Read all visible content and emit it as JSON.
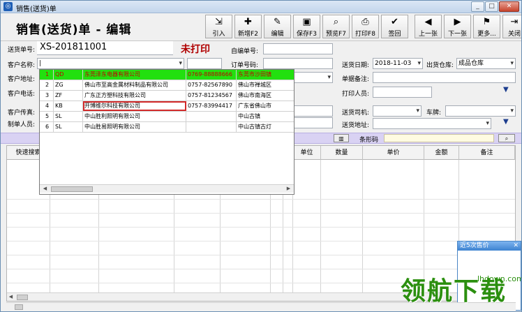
{
  "window": {
    "title": "销售(送货)单",
    "app_icon": "app-logo-icon"
  },
  "header": {
    "doc_title": "销售(送货)单 - 编辑"
  },
  "toolbar": [
    {
      "label": "引入",
      "icon": "⇲"
    },
    {
      "label": "新增F2",
      "icon": "✚"
    },
    {
      "label": "编辑",
      "icon": "✎"
    },
    {
      "label": "保存F3",
      "icon": "▣"
    },
    {
      "label": "预览F7",
      "icon": "⌕"
    },
    {
      "label": "打印F8",
      "icon": "⎙"
    },
    {
      "label": "签回",
      "icon": "✔"
    },
    {
      "label": "上一张",
      "icon": "◀"
    },
    {
      "label": "下一张",
      "icon": "▶"
    },
    {
      "label": "更多...",
      "icon": "⚑"
    },
    {
      "label": "关闭",
      "icon": "⇥"
    }
  ],
  "form": {
    "order_no_label": "送货单号:",
    "order_no": "XS-201811001",
    "status": "未打印",
    "self_no_label": "自编单号:",
    "customer_label": "客户名称:",
    "order_ref_label": "订单号码:",
    "date_label": "送货日期:",
    "date": "2018-11-03",
    "warehouse_label": "出货仓库:",
    "warehouse": "成品仓库",
    "addr_label": "客户地址:",
    "note_label": "单据备注:",
    "phone_label": "客户电话:",
    "printer_label": "打印人员:",
    "fax_label": "客户传真:",
    "driver_label": "送货司机:",
    "plate_label": "车牌:",
    "maker_label": "制单人员:",
    "ship_addr_label": "送货地址:",
    "barcode_label": "条形码"
  },
  "grid": {
    "headers": [
      "快速搜索",
      "",
      "",
      "",
      "",
      "",
      "",
      "单位",
      "数量",
      "单价",
      "金额",
      "备注"
    ]
  },
  "dropdown": {
    "rows": [
      {
        "no": "1",
        "code": "QD",
        "name": "东莞泽东电器有限公司",
        "phone": "0769-88888666",
        "region": "东莞市沙田镇"
      },
      {
        "no": "2",
        "code": "ZG",
        "name": "佛山市至高金属材料制品有限公司",
        "phone": "0757-82567890",
        "region": "佛山市禅城区"
      },
      {
        "no": "3",
        "code": "ZF",
        "name": "广东正方塑科技有限公司",
        "phone": "0757-81234567",
        "region": "佛山市南海区"
      },
      {
        "no": "4",
        "code": "KB",
        "name": "开博维尔科技有限公司",
        "phone": "0757-83994417",
        "region": "广东省佛山市"
      },
      {
        "no": "5",
        "code": "SL",
        "name": "中山胜利照明有限公司",
        "phone": "",
        "region": "中山古镇"
      },
      {
        "no": "6",
        "code": "SL",
        "name": "中山胜易照明有限公司",
        "phone": "",
        "region": "中山古镇古灯"
      }
    ]
  },
  "popup": {
    "title": "近5次售价",
    "close": "✕"
  },
  "watermark": {
    "brand": "领航下载",
    "site": "lhdown.com"
  },
  "colors": {
    "highlight_row": "#22e00f",
    "status_red": "#b00000",
    "accent_bar": "#d9d2f3"
  }
}
